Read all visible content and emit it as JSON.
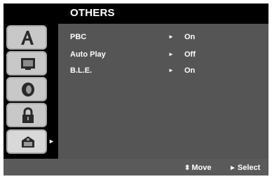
{
  "header": {
    "title": "OTHERS"
  },
  "sidebar": {
    "tabs": [
      {
        "icon": "language-icon"
      },
      {
        "icon": "display-icon"
      },
      {
        "icon": "audio-icon"
      },
      {
        "icon": "lock-icon"
      },
      {
        "icon": "others-icon",
        "active": true
      }
    ]
  },
  "menu": {
    "items": [
      {
        "label": "PBC",
        "arrow": "►",
        "value": "On"
      },
      {
        "label": "Auto Play",
        "arrow": "►",
        "value": "Off"
      },
      {
        "label": "B.L.E.",
        "arrow": "►",
        "value": "On"
      }
    ]
  },
  "footer": {
    "move_symbol": "⬍",
    "move_label": "Move",
    "select_symbol": "►",
    "select_label": "Select"
  },
  "colors": {
    "background": "#000000",
    "panel": "#555555",
    "tab": "#c8c8c8",
    "text": "#ffffff"
  }
}
